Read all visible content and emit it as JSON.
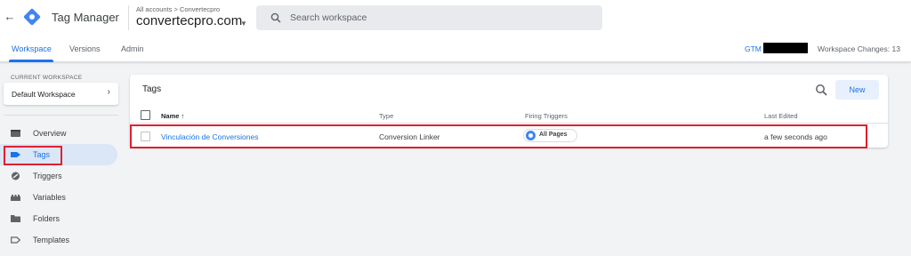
{
  "header": {
    "back_icon": "arrow-back-icon",
    "logo_icon": "tag-manager-logo-icon",
    "app_title": "Tag Manager",
    "breadcrumb": "All accounts > Convertecpro",
    "container_name": "convertecpro.com",
    "container_caret_icon": "caret-down-icon",
    "search_placeholder": "Search workspace",
    "search_icon": "search-icon"
  },
  "subnav": {
    "tabs": [
      {
        "label": "Workspace",
        "active": true
      },
      {
        "label": "Versions",
        "active": false
      },
      {
        "label": "Admin",
        "active": false
      }
    ],
    "gtm_prefix": "GTM",
    "workspace_changes": "Workspace Changes: 13"
  },
  "sidebar": {
    "current_workspace_label": "CURRENT WORKSPACE",
    "workspace_name": "Default Workspace",
    "items": [
      {
        "label": "Overview",
        "icon": "overview-icon",
        "active": false
      },
      {
        "label": "Tags",
        "icon": "tag-icon",
        "active": true
      },
      {
        "label": "Triggers",
        "icon": "trigger-icon",
        "active": false
      },
      {
        "label": "Variables",
        "icon": "variables-icon",
        "active": false
      },
      {
        "label": "Folders",
        "icon": "folder-icon",
        "active": false
      },
      {
        "label": "Templates",
        "icon": "template-icon",
        "active": false
      }
    ]
  },
  "tags_panel": {
    "title": "Tags",
    "new_button": "New",
    "columns": [
      "Name ↑",
      "Type",
      "Firing Triggers",
      "Last Edited"
    ],
    "rows": [
      {
        "name": "Vinculación de Conversiones",
        "type": "Conversion Linker",
        "trigger": "All Pages",
        "last_edited": "a few seconds ago"
      }
    ]
  },
  "colors": {
    "accent": "#1a73e8",
    "highlight": "#e0202f",
    "active_nav_bg": "#dbe6f6"
  }
}
